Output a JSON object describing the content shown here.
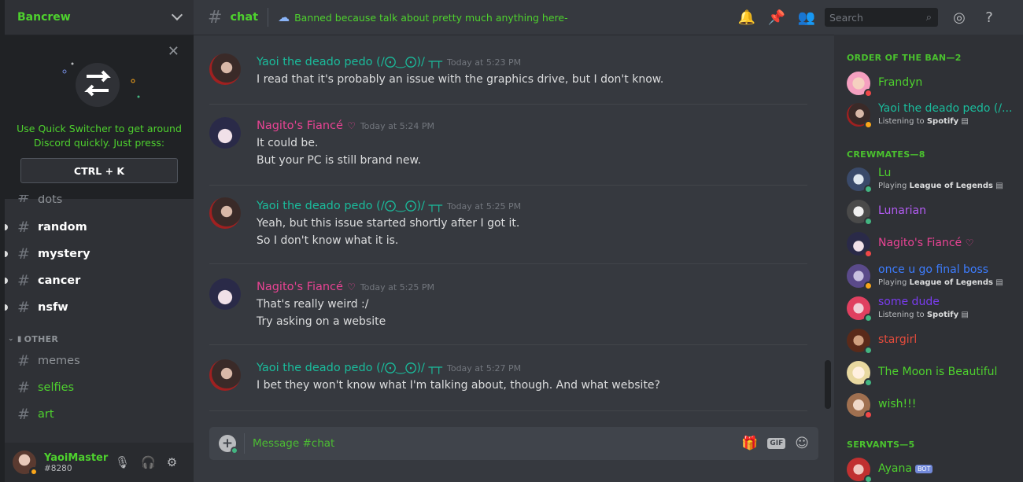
{
  "server": {
    "name": "Bancrew"
  },
  "quick_switcher": {
    "text": "Use Quick Switcher to get around Discord quickly. Just press:",
    "shortcut": "CTRL + K"
  },
  "channels": [
    {
      "name": "dots"
    },
    {
      "name": "random"
    },
    {
      "name": "mystery"
    },
    {
      "name": "cancer"
    },
    {
      "name": "nsfw"
    }
  ],
  "category_other": {
    "label": "OTHER",
    "channels": [
      {
        "name": "memes"
      },
      {
        "name": "selfies"
      },
      {
        "name": "art"
      }
    ]
  },
  "user": {
    "name": "YaoiMaster",
    "tag": "#8280"
  },
  "header": {
    "channel": "chat",
    "topic": "Banned because talk about pretty much anything here-",
    "search_placeholder": "Search"
  },
  "messages": [
    {
      "author": "Yaoi the deado pedo (/⨀‿⨀)/ ┬┬",
      "time": "Today at 5:23 PM",
      "lines": [
        "I read that it's probably an issue with the graphics drive, but I don't know."
      ]
    },
    {
      "author": "Nagito's Fiancé",
      "time": "Today at 5:24 PM",
      "lines": [
        "It could be.",
        "But your PC is still brand new."
      ]
    },
    {
      "author": "Yaoi the deado pedo (/⨀‿⨀)/ ┬┬",
      "time": "Today at 5:25 PM",
      "lines": [
        "Yeah, but this issue started shortly after I got it.",
        "So I don't know what it is."
      ]
    },
    {
      "author": "Nagito's Fiancé",
      "time": "Today at 5:25 PM",
      "lines": [
        "That's really weird :/",
        "Try asking on a website"
      ]
    },
    {
      "author": "Yaoi the deado pedo (/⨀‿⨀)/ ┬┬",
      "time": "Today at 5:27 PM",
      "lines": [
        "I bet they won't know what I'm talking about, though. And what website?"
      ]
    }
  ],
  "composer": {
    "placeholder": "Message #chat",
    "gif_label": "GIF"
  },
  "members": {
    "order_label": "ORDER OF THE BAN—2",
    "crewmates_label": "CREWMATES—8",
    "servants_label": "SERVANTS—5",
    "order": [
      {
        "name": "Frandyn",
        "color": "#4ed12e",
        "status": "#f04747"
      },
      {
        "name": "Yaoi the deado pedo (/...",
        "color": "#1abc9c",
        "status": "#faa61a",
        "activity_prefix": "Listening to",
        "activity": "Spotify"
      }
    ],
    "crewmates": [
      {
        "name": "Lu",
        "color": "#4ed12e",
        "status": "#43b581",
        "activity_prefix": "Playing",
        "activity": "League of Legends"
      },
      {
        "name": "Lunarian",
        "color": "#b45cf5",
        "status": "#43b581"
      },
      {
        "name": "Nagito's Fiancé",
        "color": "#e84393",
        "status": "#f04747"
      },
      {
        "name": "once u go final boss",
        "color": "#3d7dff",
        "status": "#faa61a",
        "activity_prefix": "Playing",
        "activity": "League of Legends"
      },
      {
        "name": "some dude",
        "color": "#7a3cf0",
        "status": "#43b581",
        "activity_prefix": "Listening to",
        "activity": "Spotify"
      },
      {
        "name": "stargirl",
        "color": "#e74c3c",
        "status": "#43b581"
      },
      {
        "name": "The Moon is Beautiful",
        "color": "#4ed12e",
        "status": "#43b581"
      },
      {
        "name": "wish!!!",
        "color": "#4ed12e",
        "status": "#f04747"
      }
    ],
    "servants": [
      {
        "name": "Ayana",
        "color": "#4ed12e",
        "status": "#43b581",
        "badge": "BOT"
      }
    ]
  }
}
